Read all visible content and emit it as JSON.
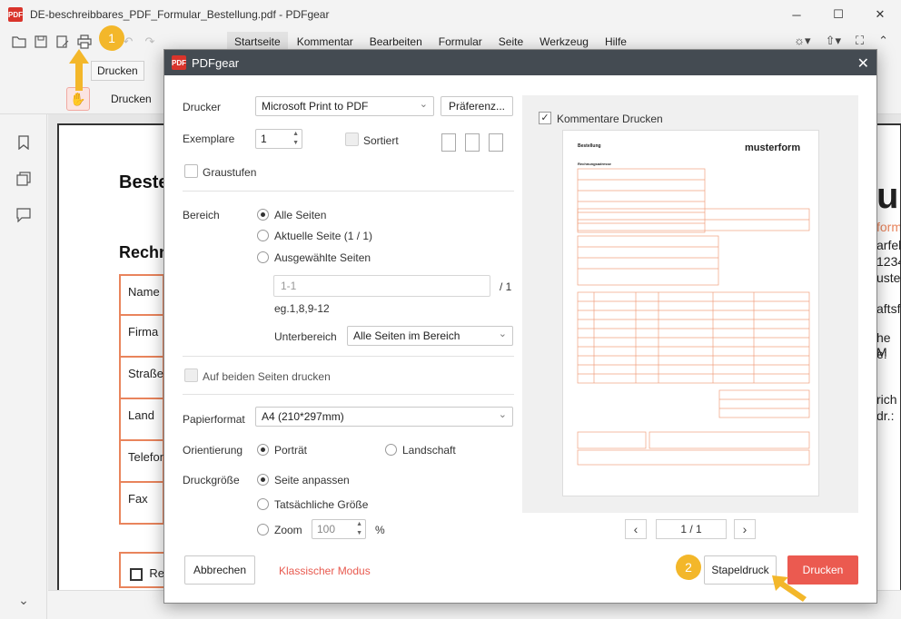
{
  "window": {
    "title": "DE-beschreibbares_PDF_Formular_Bestellung.pdf - PDFgear",
    "logo": "PDF",
    "minimize_icon": "─",
    "maximize_icon": "☐",
    "close_icon": "✕"
  },
  "menu": {
    "items": [
      "Startseite",
      "Kommentar",
      "Bearbeiten",
      "Formular",
      "Seite",
      "Werkzeug",
      "Hilfe"
    ]
  },
  "tooltip": "Drucken",
  "subbar": {
    "label": "Drucken"
  },
  "document": {
    "heading1": "Beste",
    "heading2": "Rechn",
    "rows": [
      "Name",
      "Firma",
      "Straße",
      "Land",
      "Telefon",
      "Fax"
    ],
    "checkbox_label": "Re",
    "right_peek": [
      "u",
      "form",
      "arfel",
      "1234",
      "uste",
      "aftsfu",
      "he M",
      "e:",
      "rich",
      "dr.:"
    ]
  },
  "dialog": {
    "title": "PDFgear",
    "printer_label": "Drucker",
    "printer_value": "Microsoft Print to PDF",
    "preferences_button": "Präferenz...",
    "copies_label": "Exemplare",
    "copies_value": "1",
    "sorted_label": "Sortiert",
    "grayscale_label": "Graustufen",
    "range_label": "Bereich",
    "range_options": [
      "Alle Seiten",
      "Aktuelle Seite (1 / 1)",
      "Ausgewählte Seiten"
    ],
    "range_placeholder": "1-1",
    "range_total": "/ 1",
    "range_hint": "eg.1,8,9-12",
    "subrange_label": "Unterbereich",
    "subrange_value": "Alle Seiten im Bereich",
    "duplex_label": "Auf beiden Seiten drucken",
    "paper_label": "Papierformat",
    "paper_value": "A4 (210*297mm)",
    "orientation_label": "Orientierung",
    "orientation_options": [
      "Porträt",
      "Landschaft"
    ],
    "printsize_label": "Druckgröße",
    "printsize_options": [
      "Seite anpassen",
      "Tatsächliche Größe",
      "Zoom"
    ],
    "zoom_value": "100",
    "zoom_unit": "%",
    "cancel_button": "Abbrechen",
    "classic_mode_link": "Klassischer Modus",
    "batch_print_button": "Stapeldruck",
    "print_button": "Drucken",
    "comments_label": "Kommentare Drucken",
    "comments_check": "✓",
    "page_indicator": "1 / 1",
    "prev_icon": "‹",
    "next_icon": "›"
  },
  "preview": {
    "doc_title": "Bestellung",
    "brand": "musterform",
    "section": "Rechnungsadresse"
  },
  "badges": [
    "1",
    "2"
  ],
  "colors": {
    "accent": "#e85a4f",
    "print_button": "#eb5a50",
    "badge": "#f3b72a",
    "form_border": "#e9845c",
    "dialog_header": "#444b52"
  }
}
